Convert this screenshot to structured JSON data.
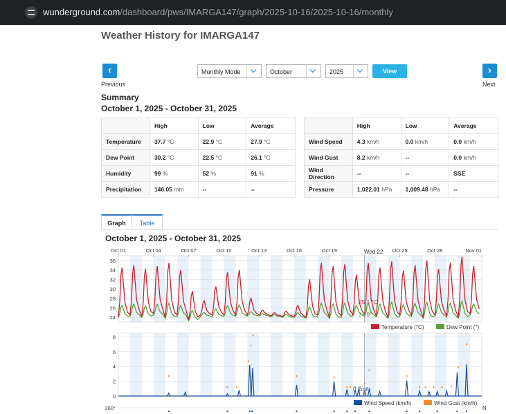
{
  "browser": {
    "url_host": "wunderground.com",
    "url_path": "/dashboard/pws/IMARGA147/graph/2025-10-16/2025-10-16/monthly"
  },
  "page": {
    "title": "Weather History for IMARGA147",
    "previous_label": "Previous",
    "next_label": "Next",
    "prev_icon": "‹",
    "next_icon": "›"
  },
  "controls": {
    "mode": "Monthly Mode",
    "month": "October",
    "year": "2025",
    "view_label": "View"
  },
  "summary": {
    "heading": "Summary",
    "range": "October 1, 2025 - October 31, 2025",
    "left_headers": [
      "High",
      "Low",
      "Average"
    ],
    "left_rows": [
      {
        "label": "Temperature",
        "high": "37.7",
        "high_unit": "°C",
        "low": "22.9",
        "low_unit": "°C",
        "avg": "27.9",
        "avg_unit": "°C"
      },
      {
        "label": "Dew Point",
        "high": "30.2",
        "high_unit": "°C",
        "low": "22.5",
        "low_unit": "°C",
        "avg": "26.1",
        "avg_unit": "°C"
      },
      {
        "label": "Humidity",
        "high": "99",
        "high_unit": "%",
        "low": "52",
        "low_unit": "%",
        "avg": "91",
        "avg_unit": "%"
      },
      {
        "label": "Precipitation",
        "high": "146.05",
        "high_unit": "mm",
        "low": "--",
        "low_unit": "",
        "avg": "--",
        "avg_unit": ""
      }
    ],
    "right_headers": [
      "High",
      "Low",
      "Average"
    ],
    "right_rows": [
      {
        "label": "Wind Speed",
        "high": "4.3",
        "high_unit": "km/h",
        "low": "0.0",
        "low_unit": "km/h",
        "avg": "0.0",
        "avg_unit": "km/h"
      },
      {
        "label": "Wind Gust",
        "high": "8.2",
        "high_unit": "km/h",
        "low": "--",
        "low_unit": "",
        "avg": "0.0",
        "avg_unit": "km/h"
      },
      {
        "label": "Wind Direction",
        "high": "--",
        "high_unit": "",
        "low": "--",
        "low_unit": "",
        "avg": "SSE",
        "avg_unit": ""
      },
      {
        "label": "Pressure",
        "high": "1,022.01",
        "high_unit": "hPa",
        "low": "1,009.48",
        "low_unit": "hPa",
        "avg": "--",
        "avg_unit": ""
      }
    ]
  },
  "tabs": [
    {
      "label": "Graph",
      "active": true
    },
    {
      "label": "Table",
      "active": false
    }
  ],
  "graph": {
    "range": "October 1, 2025 - October 31, 2025"
  },
  "colors": {
    "temperature": "#c8202f",
    "dew_point": "#5a9e35",
    "wind_speed": "#1a4f96",
    "wind_gust": "#f08a2c",
    "accent": "#1a8dd4",
    "view_button": "#2bb2e5"
  },
  "chart_data": [
    {
      "type": "line",
      "x_tick_labels": [
        "Oct 01",
        "Oct 04",
        "Oct 07",
        "Oct 10",
        "Oct 13",
        "Oct 16",
        "Oct 19",
        "Oct 25",
        "Oct 28",
        "Nov 01"
      ],
      "y_ticks": [
        24,
        26,
        28,
        30,
        32,
        34,
        36
      ],
      "ylim": [
        23,
        37
      ],
      "hover_label": "Wed 22",
      "tooltip": [
        "25.1 °C",
        "24.8°"
      ],
      "series": [
        {
          "name": "Temperature (°C)",
          "color": "#c8202f",
          "day_highs": [
            34.5,
            35.0,
            34.2,
            34.8,
            35.5,
            34.0,
            29.5,
            27.5,
            30.5,
            33.5,
            34.0,
            28.0,
            25.5,
            25.0,
            25.3,
            26.5,
            32.0,
            35.5,
            34.8,
            35.2,
            33.0,
            35.5,
            34.5,
            35.8,
            33.8,
            35.0,
            36.0,
            34.2,
            35.5,
            36.8,
            34.8
          ],
          "day_lows": [
            24.0,
            24.5,
            24.2,
            24.8,
            24.0,
            24.5,
            23.5,
            24.5,
            24.5,
            24.5,
            24.5,
            24.5,
            24.5,
            24.3,
            24.2,
            24.2,
            24.0,
            24.5,
            24.0,
            24.3,
            24.5,
            24.5,
            24.3,
            24.0,
            24.5,
            24.4,
            24.0,
            24.5,
            24.3,
            24.0,
            24.8
          ]
        },
        {
          "name": "Dew Point (°)",
          "color": "#5a9e35",
          "day_highs": [
            26.5,
            26.8,
            26.4,
            26.7,
            27.0,
            26.5,
            25.5,
            25.0,
            25.8,
            26.5,
            26.6,
            25.2,
            24.8,
            24.6,
            24.6,
            25.0,
            26.2,
            27.0,
            26.8,
            27.0,
            26.5,
            27.0,
            26.8,
            27.2,
            26.6,
            26.9,
            27.2,
            26.8,
            27.0,
            27.4,
            26.8
          ],
          "day_lows": [
            24.0,
            24.3,
            24.0,
            24.5,
            23.8,
            24.2,
            23.3,
            24.2,
            24.2,
            24.2,
            24.3,
            24.3,
            24.3,
            24.1,
            24.0,
            24.0,
            23.8,
            24.2,
            23.8,
            24.0,
            24.3,
            24.3,
            24.1,
            23.8,
            24.2,
            24.2,
            23.8,
            24.3,
            24.1,
            23.8,
            24.5
          ]
        }
      ]
    },
    {
      "type": "line",
      "y_ticks": [
        0,
        2,
        4,
        6,
        8
      ],
      "ylim": [
        0,
        8.5
      ],
      "tooltip": "0 km/h",
      "series": [
        {
          "name": "Wind Speed (km/h)",
          "color": "#1a4f96",
          "spikes": [
            {
              "day": 5.3,
              "v": 0.4
            },
            {
              "day": 6.7,
              "v": 0.5
            },
            {
              "day": 10.3,
              "v": 0.3
            },
            {
              "day": 11.3,
              "v": 0.8
            },
            {
              "day": 12.2,
              "v": 4.2
            },
            {
              "day": 12.45,
              "v": 3.8
            },
            {
              "day": 16.2,
              "v": 1.5
            },
            {
              "day": 19.4,
              "v": 2.0
            },
            {
              "day": 20.5,
              "v": 0.9
            },
            {
              "day": 21.2,
              "v": 0.8
            },
            {
              "day": 21.5,
              "v": 0.9
            },
            {
              "day": 22.0,
              "v": 0.8
            },
            {
              "day": 22.4,
              "v": 0.9
            },
            {
              "day": 23.3,
              "v": 0.6
            },
            {
              "day": 25.6,
              "v": 2.1
            },
            {
              "day": 26.7,
              "v": 0.7
            },
            {
              "day": 27.5,
              "v": 0.6
            },
            {
              "day": 28.2,
              "v": 0.6
            },
            {
              "day": 29.0,
              "v": 0.7
            },
            {
              "day": 29.9,
              "v": 3.2
            },
            {
              "day": 30.7,
              "v": 4.3
            }
          ]
        },
        {
          "name": "Wind Gust (km/h)",
          "color": "#f08a2c",
          "points": [
            {
              "day": 5.3,
              "v": 2.7
            },
            {
              "day": 10.3,
              "v": 1.2
            },
            {
              "day": 11.1,
              "v": 1.2
            },
            {
              "day": 12.1,
              "v": 4.7
            },
            {
              "day": 12.3,
              "v": 6.8
            },
            {
              "day": 12.5,
              "v": 8.2
            },
            {
              "day": 16.2,
              "v": 2.7
            },
            {
              "day": 19.4,
              "v": 2.5
            },
            {
              "day": 20.5,
              "v": 1.2
            },
            {
              "day": 20.8,
              "v": 1.2
            },
            {
              "day": 21.2,
              "v": 1.2
            },
            {
              "day": 21.6,
              "v": 1.2
            },
            {
              "day": 22.0,
              "v": 1.7
            },
            {
              "day": 22.4,
              "v": 3.5
            },
            {
              "day": 25.6,
              "v": 2.7
            },
            {
              "day": 26.7,
              "v": 1.2
            },
            {
              "day": 27.2,
              "v": 1.2
            },
            {
              "day": 27.9,
              "v": 1.2
            },
            {
              "day": 28.6,
              "v": 1.2
            },
            {
              "day": 29.4,
              "v": 1.3
            },
            {
              "day": 30.0,
              "v": 3.9
            },
            {
              "day": 30.7,
              "v": 7.0
            }
          ]
        }
      ]
    },
    {
      "type": "scatter",
      "y_ticks": [
        "360°"
      ],
      "right_label": "N"
    }
  ]
}
